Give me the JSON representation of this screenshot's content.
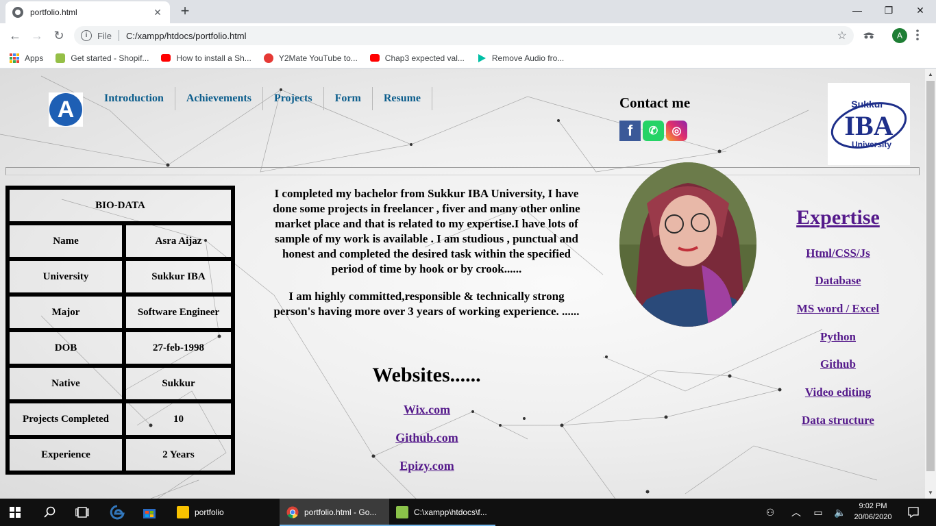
{
  "browser": {
    "tab_title": "portfolio.html",
    "tab_close": "✕",
    "new_tab": "+",
    "window_controls": {
      "minimize": "—",
      "maximize": "❐",
      "close": "✕"
    },
    "nav": {
      "back": "←",
      "forward": "→",
      "reload": "↻"
    },
    "address": {
      "info_icon": "i",
      "scheme_label": "File",
      "url": "C:/xampp/htdocs/portfolio.html",
      "star": "☆"
    },
    "profile_initial": "A",
    "bookmarks": [
      {
        "label": "Apps",
        "icon": "apps-grid-icon",
        "color": ""
      },
      {
        "label": "Get started - Shopif...",
        "icon": "shopify-icon",
        "color": "#95bf47"
      },
      {
        "label": "How to install a Sh...",
        "icon": "youtube-icon",
        "color": "#ff0000"
      },
      {
        "label": "Y2Mate YouTube to...",
        "icon": "y2mate-icon",
        "color": "#e53935"
      },
      {
        "label": "Chap3 expected val...",
        "icon": "youtube-icon",
        "color": "#ff0000"
      },
      {
        "label": "Remove Audio fro...",
        "icon": "play-icon",
        "color": "#00bfa5"
      }
    ]
  },
  "page": {
    "logo_letter": "A",
    "nav": [
      "Introduction",
      "Achievements",
      "Projects",
      "Form",
      "Resume"
    ],
    "contact_title": "Contact me",
    "social_icons": [
      "facebook-icon",
      "whatsapp-icon",
      "instagram-icon"
    ],
    "social_glyphs": {
      "facebook": "f",
      "whatsapp": "✆",
      "instagram": "◎"
    },
    "iba_logo": {
      "line1": "Sukkur",
      "line2": "IBA",
      "line3": "University"
    },
    "biodata": {
      "header": "BIO-DATA",
      "rows": [
        {
          "label": "Name",
          "value": "Asra Aijaz"
        },
        {
          "label": "University",
          "value": "Sukkur IBA"
        },
        {
          "label": "Major",
          "value": "Software Engineer"
        },
        {
          "label": "DOB",
          "value": "27-feb-1998"
        },
        {
          "label": "Native",
          "value": "Sukkur"
        },
        {
          "label": "Projects Completed",
          "value": "10"
        },
        {
          "label": "Experience",
          "value": "2 Years"
        }
      ]
    },
    "about": {
      "p1": "I completed my bachelor from Sukkur IBA University, I have done some projects in freelancer , fiver and many other online market place and that is related to my expertise.I have lots of sample of my work is available . I am studious , punctual and honest and completed the desired task within the specified period of time by hook or by crook......",
      "p2": "I am highly committed,responsible & technically strong person's having more over 3 years of working experience. ......"
    },
    "websites_title": "Websites......",
    "websites": [
      "Wix.com",
      "Github.com",
      "Epizy.com"
    ],
    "expertise_title": "Expertise",
    "expertise": [
      "Html/CSS/Js",
      "Database",
      "MS word / Excel",
      "Python",
      "Github",
      "Video editing",
      "Data structure"
    ]
  },
  "taskbar": {
    "apps": [
      {
        "label": "portfolio",
        "icon": "folder-icon",
        "color": "#f8c200"
      },
      {
        "label": "portfolio.html - Go...",
        "icon": "chrome-icon",
        "color": "#4285f4"
      },
      {
        "label": "C:\\xampp\\htdocs\\f...",
        "icon": "notepad-icon",
        "color": "#8bc34a"
      }
    ],
    "time": "9:02 PM",
    "date": "20/06/2020"
  },
  "colors": {
    "nav_link": "#0b5d8c",
    "visited_link": "#551a8b",
    "logo_blue": "#1e5fb4",
    "taskbar": "#101010"
  }
}
